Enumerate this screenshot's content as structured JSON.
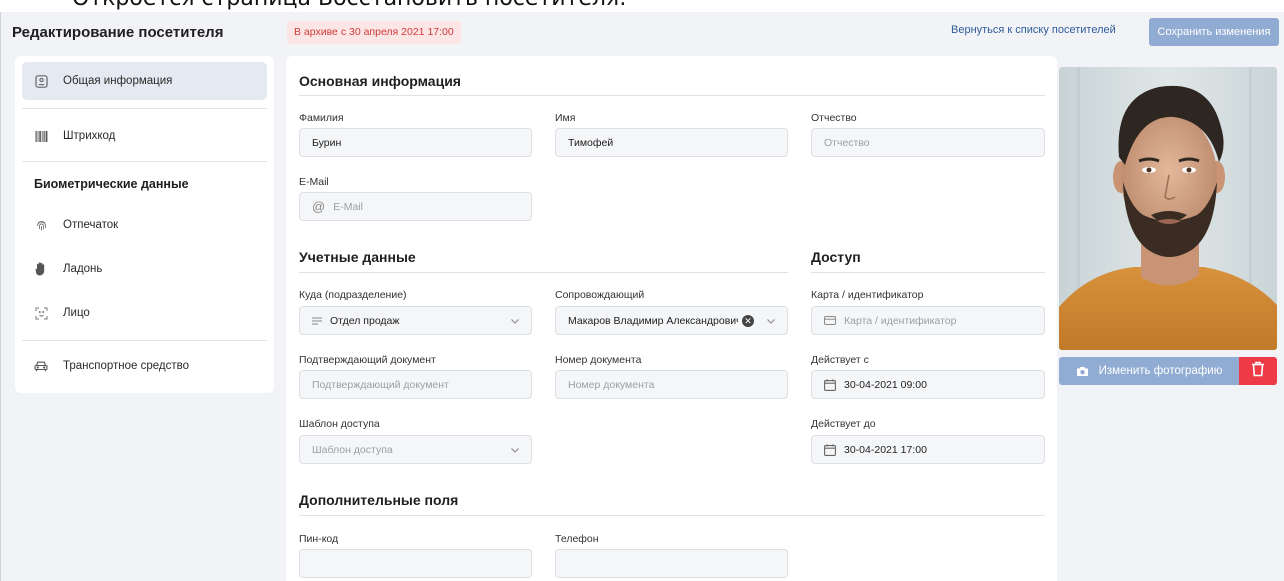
{
  "caption": "Откроется страница Восстановить посетителя:",
  "header": {
    "title": "Редактирование посетителя",
    "archive_badge": "В архиве с 30 апреля 2021 17:00",
    "back_link": "Вернуться к списку посетителей",
    "save_label": "Сохранить изменения"
  },
  "sidebar": {
    "items": [
      {
        "label": "Общая информация",
        "icon": "id-card-icon"
      },
      {
        "label": "Штрихкод",
        "icon": "barcode-icon"
      },
      {
        "label": "Отпечаток",
        "icon": "fingerprint-icon"
      },
      {
        "label": "Ладонь",
        "icon": "palm-icon"
      },
      {
        "label": "Лицо",
        "icon": "face-scan-icon"
      },
      {
        "label": "Транспортное средство",
        "icon": "car-icon"
      }
    ],
    "biometrics_heading": "Биометрические данные"
  },
  "main": {
    "basic_info": {
      "title": "Основная информация",
      "last_name": {
        "label": "Фамилия",
        "value": "Бурин"
      },
      "first_name": {
        "label": "Имя",
        "value": "Тимофей"
      },
      "middle_name": {
        "label": "Отчество",
        "placeholder": "Отчество"
      },
      "email": {
        "label": "E-Mail",
        "placeholder": "E-Mail"
      }
    },
    "account": {
      "title": "Учетные данные",
      "department": {
        "label": "Куда (подразделение)",
        "value": "Отдел продаж"
      },
      "escort": {
        "label": "Сопровождающий",
        "value": "Макаров Владимир Александрович"
      },
      "doc": {
        "label": "Подтверждающий документ",
        "placeholder": "Подтверждающий документ"
      },
      "doc_number": {
        "label": "Номер документа",
        "placeholder": "Номер документа"
      },
      "template": {
        "label": "Шаблон доступа",
        "placeholder": "Шаблон доступа"
      }
    },
    "access": {
      "title": "Доступ",
      "card": {
        "label": "Карта / идентификатор",
        "placeholder": "Карта / идентификатор"
      },
      "valid_from": {
        "label": "Действует с",
        "value": "30-04-2021 09:00"
      },
      "valid_to": {
        "label": "Действует до",
        "value": "30-04-2021 17:00"
      }
    },
    "extra": {
      "title": "Дополнительные поля",
      "pin": {
        "label": "Пин-код",
        "value": ""
      },
      "phone": {
        "label": "Телефон",
        "value": ""
      }
    }
  },
  "photo": {
    "change_label": "Изменить фотографию"
  },
  "colors": {
    "accent": "#91acd3",
    "danger": "#ee3a46",
    "archive_bg": "#fbe5e5",
    "archive_text": "#d13b3b"
  }
}
